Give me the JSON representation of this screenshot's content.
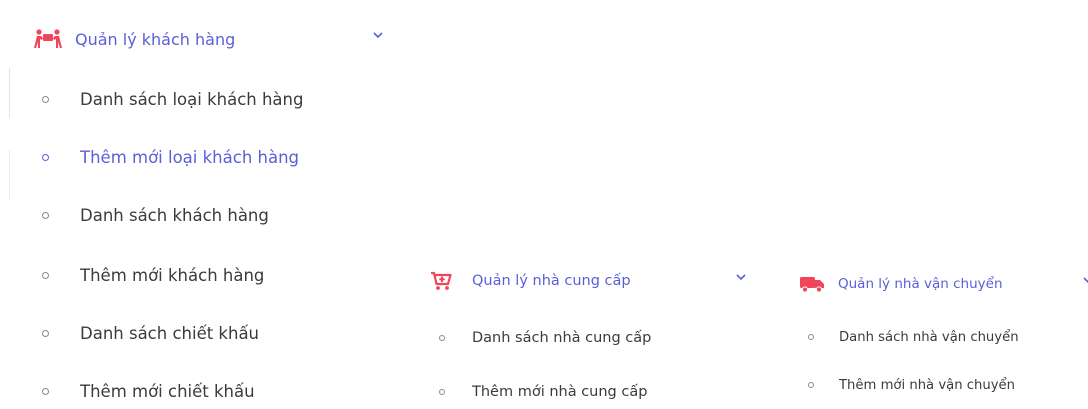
{
  "customer_menu": {
    "title": "Quản lý khách hàng",
    "icon": "people-carry-icon",
    "items": [
      {
        "label": "Danh sách loại khách hàng",
        "active": false
      },
      {
        "label": "Thêm mới loại khách hàng",
        "active": true
      },
      {
        "label": "Danh sách khách hàng",
        "active": false
      },
      {
        "label": "Thêm mới khách hàng",
        "active": false
      },
      {
        "label": "Danh sách chiết khấu",
        "active": false
      },
      {
        "label": "Thêm mới chiết khấu",
        "active": false
      }
    ]
  },
  "supplier_menu": {
    "title": "Quản lý nhà cung cấp",
    "icon": "cart-plus-icon",
    "items": [
      {
        "label": "Danh sách nhà cung cấp"
      },
      {
        "label": "Thêm mới nhà cung cấp"
      }
    ]
  },
  "shipper_menu": {
    "title": "Quản lý nhà vận chuyển",
    "icon": "truck-icon",
    "items": [
      {
        "label": "Danh sách nhà vận chuyển"
      },
      {
        "label": "Thêm mới nhà vận chuyển"
      }
    ]
  },
  "colors": {
    "accent": "#5b5fd6",
    "icon": "#f0455b",
    "text": "#3b3b3b"
  }
}
